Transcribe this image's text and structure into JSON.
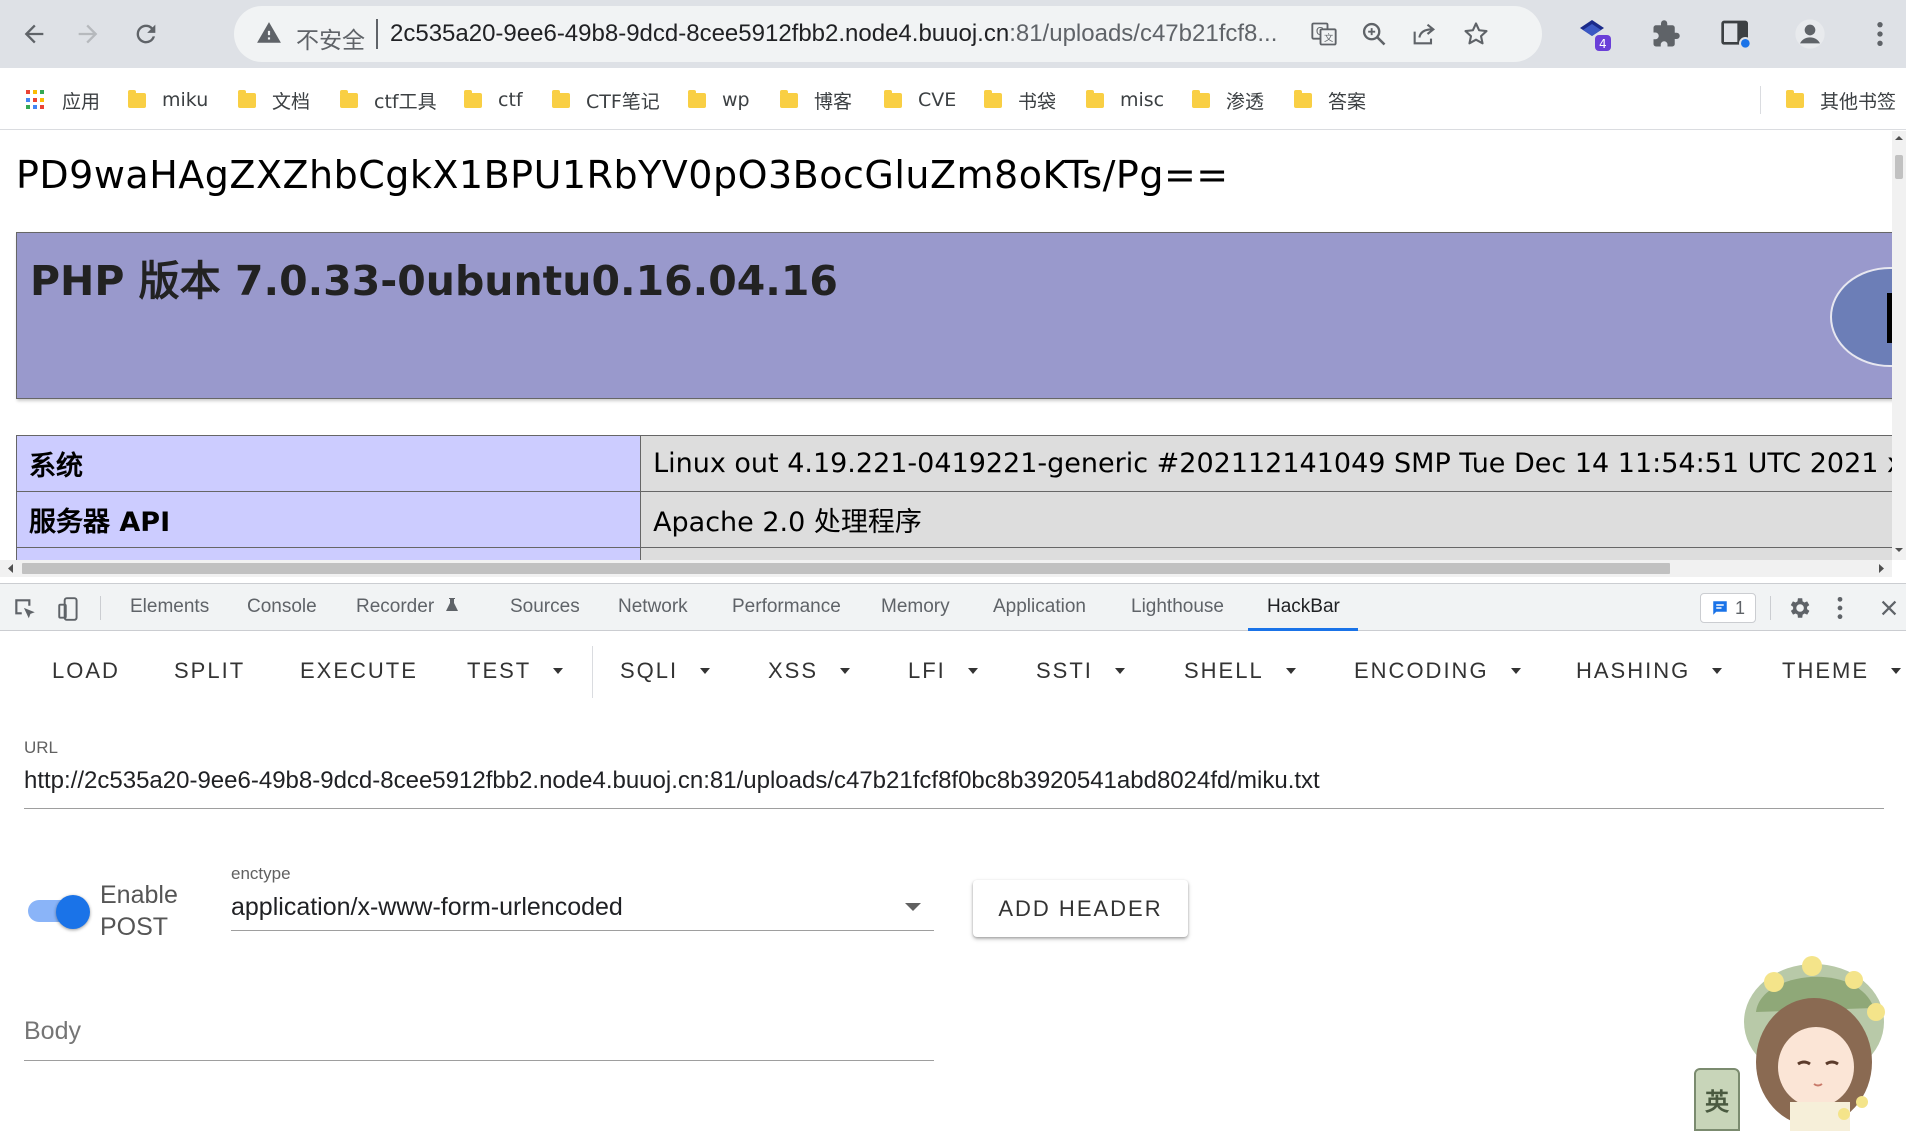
{
  "browser": {
    "insecure_label": "不安全",
    "url_host": "2c535a20-9ee6-49b8-9dcd-8cee5912fbb2.node4.buuoj.cn",
    "url_path": ":81/uploads/c47b21fcf8...",
    "extension_badge": "4"
  },
  "bookmarks": {
    "items": [
      {
        "label": "应用"
      },
      {
        "label": "miku"
      },
      {
        "label": "文档"
      },
      {
        "label": "ctf工具"
      },
      {
        "label": "ctf"
      },
      {
        "label": "CTF笔记"
      },
      {
        "label": "wp"
      },
      {
        "label": "博客"
      },
      {
        "label": "CVE"
      },
      {
        "label": "书袋"
      },
      {
        "label": "misc"
      },
      {
        "label": "渗透"
      },
      {
        "label": "答案"
      }
    ],
    "other": "其他书签"
  },
  "page": {
    "base64_text": "PD9waHAgZXZhbCgkX1BPU1RbYV0pO3BocGluZm8oKTs/Pg==",
    "php_title": "PHP 版本 7.0.33-0ubuntu0.16.04.16",
    "rows": [
      {
        "key": "系统",
        "value": "Linux out 4.19.221-0419221-generic #202112141049 SMP Tue Dec 14 11:54:51 UTC 2021 x"
      },
      {
        "key": "服务器 API",
        "value": "Apache 2.0 处理程序"
      }
    ]
  },
  "devtools": {
    "tabs": [
      "Elements",
      "Console",
      "Recorder",
      "Sources",
      "Network",
      "Performance",
      "Memory",
      "Application",
      "Lighthouse",
      "HackBar"
    ],
    "active_tab": "HackBar",
    "issues_count": "1"
  },
  "hackbar": {
    "menu": [
      "LOAD",
      "SPLIT",
      "EXECUTE",
      "TEST",
      "SQLI",
      "XSS",
      "LFI",
      "SSTI",
      "SHELL",
      "ENCODING",
      "HASHING",
      "THEME"
    ],
    "url_label": "URL",
    "url_value": "http://2c535a20-9ee6-49b8-9dcd-8cee5912fbb2.node4.buuoj.cn:81/uploads/c47b21fcf8f0bc8b3920541abd8024fd/miku.txt",
    "toggle_label_line1": "Enable",
    "toggle_label_line2": "POST",
    "toggle_enabled": true,
    "enctype_label": "enctype",
    "enctype_value": "application/x-www-form-urlencoded",
    "add_header_label": "ADD HEADER",
    "body_placeholder": "Body"
  },
  "ime": {
    "label": "英"
  },
  "colors": {
    "accent": "#1a73e8",
    "php_header": "#9999cc",
    "php_key_cell": "#ccccff",
    "php_value_cell": "#dddddd"
  }
}
